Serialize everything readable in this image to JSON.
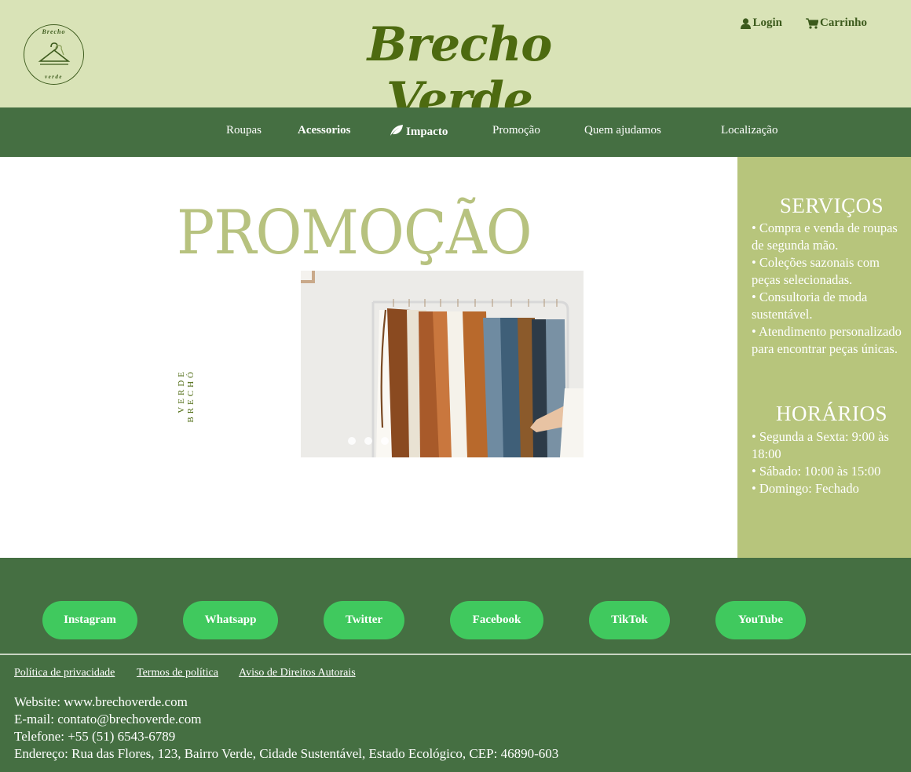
{
  "header": {
    "logo_top_text": "Brecho",
    "logo_bottom_text": "verde",
    "brand": "Brecho Verde",
    "login_label": "Login",
    "cart_label": "Carrinho",
    "login_icon": "user-icon",
    "cart_icon": "cart-icon"
  },
  "nav": {
    "items": [
      {
        "label": "Roupas"
      },
      {
        "label": "Acessorios"
      },
      {
        "label": "Impacto",
        "icon": "leaf-icon"
      },
      {
        "label": "Promoção"
      },
      {
        "label": "Quem ajudamos"
      },
      {
        "label": "Localização"
      }
    ]
  },
  "main": {
    "title": "PROMOÇÃO",
    "vertical_line1": "BRECHÓ",
    "vertical_line2": "VERDE",
    "carousel": {
      "slides": 3,
      "active": 1,
      "image_icon": "clothing-rack-image"
    }
  },
  "sidebar": {
    "services_title": "SERVIÇOS",
    "services": [
      "• Compra e venda de roupas de segunda mão.",
      "• Coleções sazonais com peças selecionadas.",
      "• Consultoria de moda sustentável.",
      "• Atendimento personalizado para encontrar peças únicas."
    ],
    "hours_title": "HORÁRIOS",
    "hours": [
      "• Segunda a Sexta: 9:00 às 18:00",
      "• Sábado: 10:00 às 15:00",
      "• Domingo: Fechado"
    ]
  },
  "footer": {
    "social": [
      "Instagram",
      "Whatsapp",
      "Twitter",
      "Facebook",
      "TikTok",
      "YouTube"
    ],
    "policies": [
      "Política de privacidade",
      "Termos de política",
      "Aviso de Direitos Autorais"
    ],
    "contact": [
      "Website: www.brechoverde.com",
      "E-mail: contato@brechoverde.com",
      "Telefone: +55 (51) 6543-6789",
      "Endereço: Rua das Flores, 123, Bairro Verde, Cidade Sustentável, Estado Ecológico, CEP: 46890-603"
    ]
  },
  "colors": {
    "header_bg": "#d9e3b7",
    "nav_bg": "#456f42",
    "sidebar_bg": "#b7c57c",
    "brand": "#4d6a10",
    "social_button": "#40c95e"
  }
}
